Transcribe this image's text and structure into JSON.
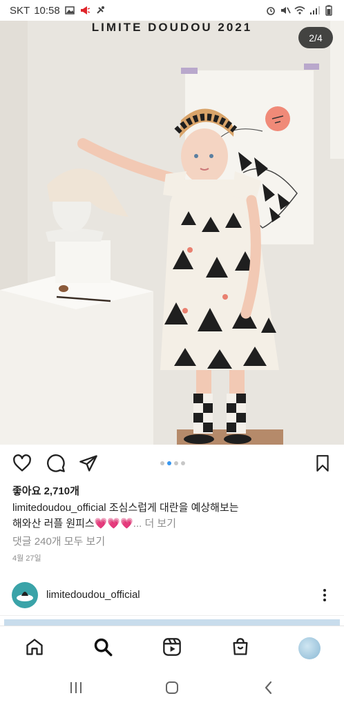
{
  "status_bar": {
    "carrier": "SKT",
    "time": "10:58",
    "left_icons": [
      "image-icon",
      "megaphone-icon",
      "no-ring-icon"
    ],
    "right_icons": [
      "alarm-icon",
      "mute-icon",
      "wifi-icon",
      "signal-icon",
      "battery-icon"
    ]
  },
  "post": {
    "photo_brand": "LIMITE DOUDOU 2021",
    "page_indicator": "2/4",
    "carousel": {
      "total": 4,
      "active_index": 1
    },
    "likes": "좋아요 2,710개",
    "username": "limitedoudou_official",
    "caption_text_1": "조심스럽게 대란을 예상해보는",
    "caption_text_2": "해와산 러플 원피스",
    "caption_hearts": "💗💗💗",
    "more_label": "... 더 보기",
    "view_comments": "댓글 240개 모두 보기",
    "date": "4월 27일"
  },
  "next_post": {
    "username": "limitedoudou_official"
  },
  "colors": {
    "accent_blue": "#3897f0",
    "muted_text": "#8e8e8e",
    "pill_bg": "#1e1e1e"
  }
}
